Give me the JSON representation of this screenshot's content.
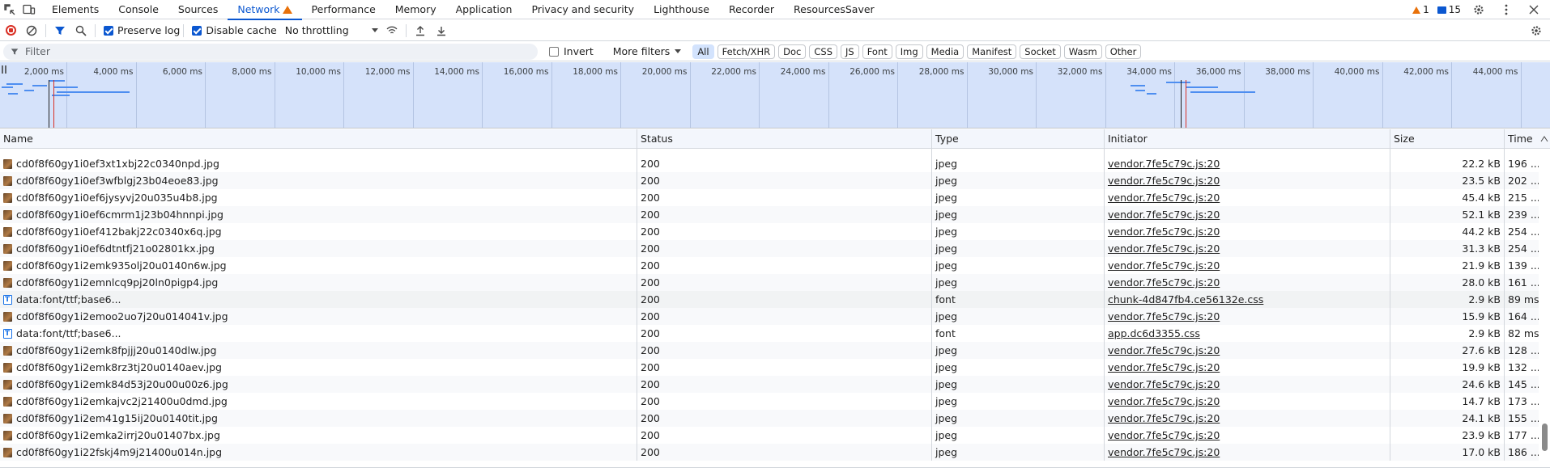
{
  "tabs": [
    {
      "label": "Elements"
    },
    {
      "label": "Console"
    },
    {
      "label": "Sources"
    },
    {
      "label": "Network",
      "active": true
    },
    {
      "label": "Performance"
    },
    {
      "label": "Memory"
    },
    {
      "label": "Application"
    },
    {
      "label": "Privacy and security"
    },
    {
      "label": "Lighthouse"
    },
    {
      "label": "Recorder"
    },
    {
      "label": "ResourcesSaver"
    }
  ],
  "badges": {
    "warnings": "1",
    "messages": "15"
  },
  "toolbar": {
    "preserve_log": "Preserve log",
    "disable_cache": "Disable cache",
    "throttling": "No throttling"
  },
  "filter": {
    "placeholder": "Filter",
    "invert": "Invert",
    "more_filters": "More filters",
    "chips": [
      "All",
      "Fetch/XHR",
      "Doc",
      "CSS",
      "JS",
      "Font",
      "Img",
      "Media",
      "Manifest",
      "Socket",
      "Wasm",
      "Other"
    ]
  },
  "overview": {
    "ticks": [
      "2,000 ms",
      "4,000 ms",
      "6,000 ms",
      "8,000 ms",
      "10,000 ms",
      "12,000 ms",
      "14,000 ms",
      "16,000 ms",
      "18,000 ms",
      "20,000 ms",
      "22,000 ms",
      "24,000 ms",
      "26,000 ms",
      "28,000 ms",
      "30,000 ms",
      "32,000 ms",
      "34,000 ms",
      "36,000 ms",
      "38,000 ms",
      "40,000 ms",
      "42,000 ms",
      "44,000 ms"
    ]
  },
  "columns": {
    "name": "Name",
    "status": "Status",
    "type": "Type",
    "initiator": "Initiator",
    "size": "Size",
    "time": "Time"
  },
  "rows": [
    {
      "name": "cd0f8f60gy1i0ef3xt1xbj22c0340npd.jpg",
      "status": "200",
      "type": "jpeg",
      "initiator": "vendor.7fe5c79c.js:20",
      "size": "22.2 kB",
      "time": "196 ...",
      "icon": "img"
    },
    {
      "name": "cd0f8f60gy1i0ef3wfblgj23b04eoe83.jpg",
      "status": "200",
      "type": "jpeg",
      "initiator": "vendor.7fe5c79c.js:20",
      "size": "23.5 kB",
      "time": "202 ...",
      "icon": "img"
    },
    {
      "name": "cd0f8f60gy1i0ef6jysyvj20u035u4b8.jpg",
      "status": "200",
      "type": "jpeg",
      "initiator": "vendor.7fe5c79c.js:20",
      "size": "45.4 kB",
      "time": "215 ...",
      "icon": "img"
    },
    {
      "name": "cd0f8f60gy1i0ef6cmrm1j23b04hnnpi.jpg",
      "status": "200",
      "type": "jpeg",
      "initiator": "vendor.7fe5c79c.js:20",
      "size": "52.1 kB",
      "time": "239 ...",
      "icon": "img"
    },
    {
      "name": "cd0f8f60gy1i0ef412bakj22c0340x6q.jpg",
      "status": "200",
      "type": "jpeg",
      "initiator": "vendor.7fe5c79c.js:20",
      "size": "44.2 kB",
      "time": "254 ...",
      "icon": "img"
    },
    {
      "name": "cd0f8f60gy1i0ef6dtntfj21o02801kx.jpg",
      "status": "200",
      "type": "jpeg",
      "initiator": "vendor.7fe5c79c.js:20",
      "size": "31.3 kB",
      "time": "254 ...",
      "icon": "img"
    },
    {
      "name": "cd0f8f60gy1i2emk935olj20u0140n6w.jpg",
      "status": "200",
      "type": "jpeg",
      "initiator": "vendor.7fe5c79c.js:20",
      "size": "21.9 kB",
      "time": "139 ...",
      "icon": "img"
    },
    {
      "name": "cd0f8f60gy1i2emnlcq9pj20ln0pigp4.jpg",
      "status": "200",
      "type": "jpeg",
      "initiator": "vendor.7fe5c79c.js:20",
      "size": "28.0 kB",
      "time": "161 ...",
      "icon": "img"
    },
    {
      "name": "data:font/ttf;base6...",
      "status": "200",
      "type": "font",
      "initiator": "chunk-4d847fb4.ce56132e.css",
      "size": "2.9 kB",
      "time": "89 ms",
      "icon": "font",
      "hl": true
    },
    {
      "name": "cd0f8f60gy1i2emoo2uo7j20u014041v.jpg",
      "status": "200",
      "type": "jpeg",
      "initiator": "vendor.7fe5c79c.js:20",
      "size": "15.9 kB",
      "time": "164 ...",
      "icon": "img"
    },
    {
      "name": "data:font/ttf;base6...",
      "status": "200",
      "type": "font",
      "initiator": "app.dc6d3355.css",
      "size": "2.9 kB",
      "time": "82 ms",
      "icon": "font"
    },
    {
      "name": "cd0f8f60gy1i2emk8fpjjj20u0140dlw.jpg",
      "status": "200",
      "type": "jpeg",
      "initiator": "vendor.7fe5c79c.js:20",
      "size": "27.6 kB",
      "time": "128 ...",
      "icon": "img"
    },
    {
      "name": "cd0f8f60gy1i2emk8rz3tj20u0140aev.jpg",
      "status": "200",
      "type": "jpeg",
      "initiator": "vendor.7fe5c79c.js:20",
      "size": "19.9 kB",
      "time": "132 ...",
      "icon": "img"
    },
    {
      "name": "cd0f8f60gy1i2emk84d53j20u00u00z6.jpg",
      "status": "200",
      "type": "jpeg",
      "initiator": "vendor.7fe5c79c.js:20",
      "size": "24.6 kB",
      "time": "145 ...",
      "icon": "img"
    },
    {
      "name": "cd0f8f60gy1i2emkajvc2j21400u0dmd.jpg",
      "status": "200",
      "type": "jpeg",
      "initiator": "vendor.7fe5c79c.js:20",
      "size": "14.7 kB",
      "time": "173 ...",
      "icon": "img"
    },
    {
      "name": "cd0f8f60gy1i2em41g15ij20u0140tit.jpg",
      "status": "200",
      "type": "jpeg",
      "initiator": "vendor.7fe5c79c.js:20",
      "size": "24.1 kB",
      "time": "155 ...",
      "icon": "img"
    },
    {
      "name": "cd0f8f60gy1i2emka2irrj20u01407bx.jpg",
      "status": "200",
      "type": "jpeg",
      "initiator": "vendor.7fe5c79c.js:20",
      "size": "23.9 kB",
      "time": "177 ...",
      "icon": "img"
    },
    {
      "name": "cd0f8f60gy1i22fskj4m9j21400u014n.jpg",
      "status": "200",
      "type": "jpeg",
      "initiator": "vendor.7fe5c79c.js:20",
      "size": "17.0 kB",
      "time": "186 ...",
      "icon": "img"
    }
  ]
}
